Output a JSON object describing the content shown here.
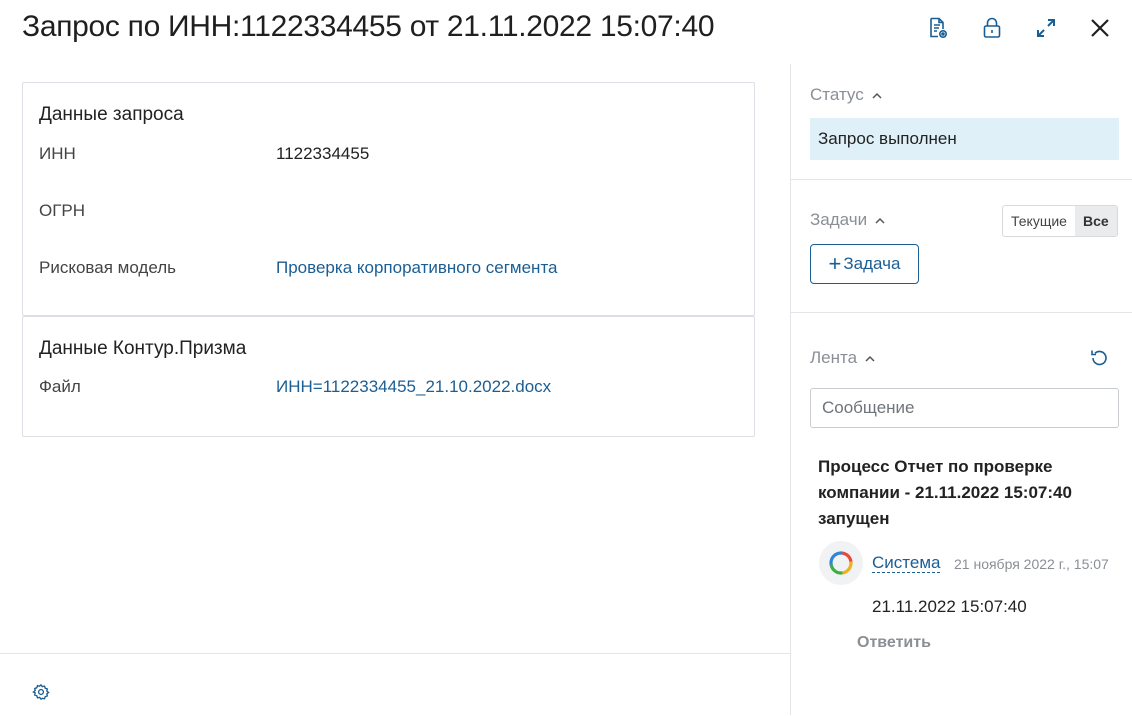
{
  "header": {
    "title": "Запрос по ИНН:1122334455 от 21.11.2022 15:07:40",
    "icons": [
      "document-settings-icon",
      "lock-icon",
      "expand-icon",
      "close-icon"
    ]
  },
  "request_card": {
    "title": "Данные запроса",
    "rows": [
      {
        "label": "ИНН",
        "value": "1122334455"
      },
      {
        "label": "ОГРН",
        "value": ""
      },
      {
        "label": "Рисковая модель",
        "value": "Проверка корпоративного сегмента"
      }
    ]
  },
  "kontur_card": {
    "title": "Данные Контур.Призма",
    "rows": [
      {
        "label": "Файл",
        "value": "ИНН=1122334455_21.10.2022.docx"
      }
    ]
  },
  "sidebar": {
    "status": {
      "title": "Статус",
      "value": "Запрос выполнен"
    },
    "tasks": {
      "title": "Задачи",
      "filter_current": "Текущие",
      "filter_all": "Все",
      "add_button": "Задача"
    },
    "feed": {
      "title": "Лента",
      "message_placeholder": "Сообщение",
      "entry": {
        "text": "Процесс Отчет по проверке компании - 21.11.2022 15:07:40 запущен",
        "author": "Система",
        "timestamp": "21 ноября 2022 г., 15:07",
        "body": "21.11.2022 15:07:40",
        "reply": "Ответить"
      }
    }
  },
  "colors": {
    "accent": "#1b5e94",
    "status_bg": "#dff0f8",
    "border": "#dcdfe3"
  }
}
